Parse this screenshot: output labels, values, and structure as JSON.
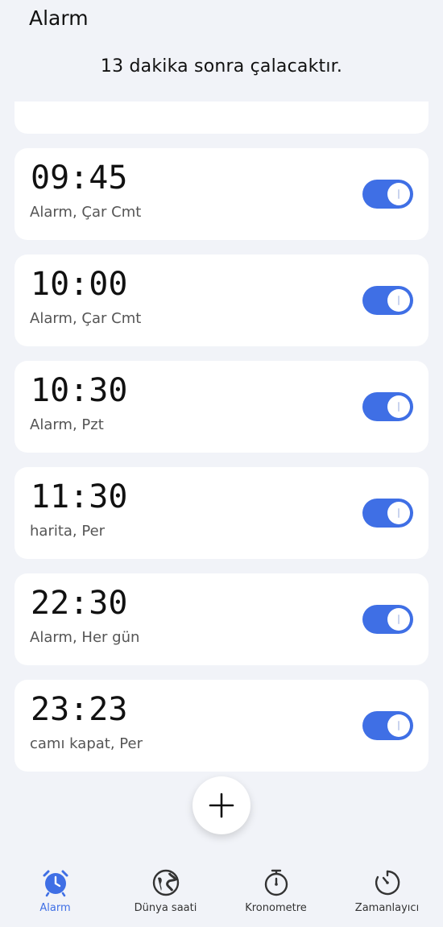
{
  "header": {
    "title": "Alarm",
    "next_alarm_text": "13 dakika sonra çalacaktır."
  },
  "alarms": [
    {
      "time": "09:45",
      "label": "Alarm, Çar Cmt",
      "enabled": true
    },
    {
      "time": "10:00",
      "label": "Alarm, Çar Cmt",
      "enabled": true
    },
    {
      "time": "10:30",
      "label": "Alarm, Pzt",
      "enabled": true
    },
    {
      "time": "11:30",
      "label": "harita, Per",
      "enabled": true
    },
    {
      "time": "22:30",
      "label": "Alarm, Her gün",
      "enabled": true
    },
    {
      "time": "23:23",
      "label": "camı kapat, Per",
      "enabled": true
    }
  ],
  "nav": {
    "items": [
      {
        "label": "Alarm",
        "icon": "alarm-clock-icon",
        "active": true
      },
      {
        "label": "Dünya saati",
        "icon": "globe-icon",
        "active": false
      },
      {
        "label": "Kronometre",
        "icon": "stopwatch-icon",
        "active": false
      },
      {
        "label": "Zamanlayıcı",
        "icon": "timer-icon",
        "active": false
      }
    ]
  },
  "colors": {
    "accent": "#3f6fe5",
    "background": "#f1f3f8",
    "card": "#ffffff"
  }
}
